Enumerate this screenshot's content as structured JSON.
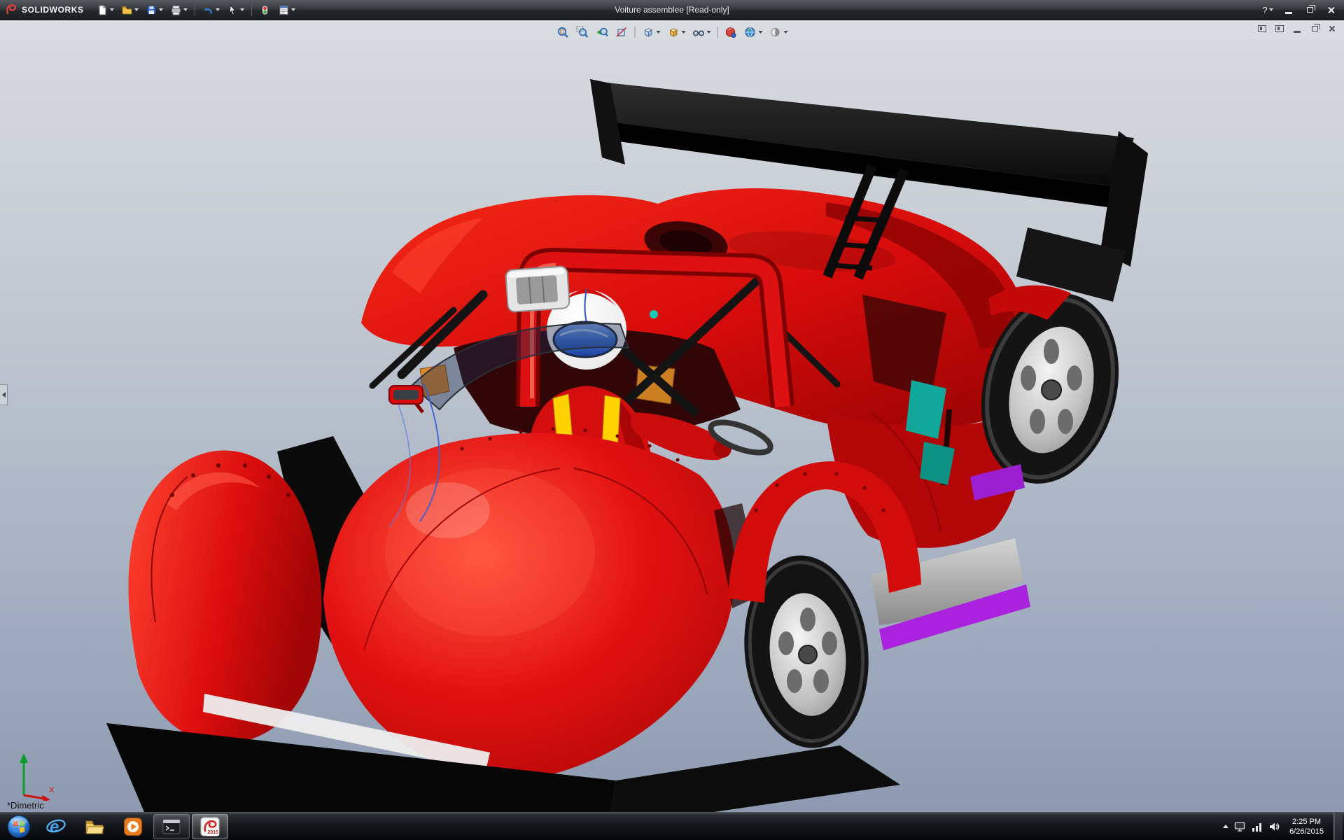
{
  "window": {
    "brand": "SOLIDWORKS",
    "title": "Voiture assemblee [Read-only]",
    "help_glyph": "?"
  },
  "main_toolbar": {
    "items": [
      {
        "name": "new-document",
        "dropdown": true
      },
      {
        "name": "open-document",
        "dropdown": true
      },
      {
        "name": "save",
        "dropdown": true
      },
      {
        "name": "print",
        "dropdown": true
      },
      {
        "name": "undo",
        "dropdown": true
      },
      {
        "name": "select",
        "dropdown": true
      },
      {
        "name": "rebuild",
        "dropdown": false
      },
      {
        "name": "file-properties",
        "dropdown": true
      }
    ]
  },
  "hud_toolbar": {
    "items": [
      "zoom-to-fit",
      "zoom-to-area",
      "previous-view",
      "section-view",
      "view-orientation",
      "display-style",
      "hide-show-items",
      "edit-appearance",
      "apply-scene",
      "view-settings"
    ]
  },
  "viewport": {
    "view_label": "*Dimetric",
    "triad": {
      "x_label": "X"
    }
  },
  "model": {
    "name": "Voiture assemblee",
    "body_color": "#d90c0c",
    "wing_color": "#111111",
    "accent_teal": "#11a79b",
    "accent_magenta": "#aa22dd",
    "rim_color": "#c6c6c6"
  },
  "taskbar": {
    "apps": [
      {
        "name": "internet-explorer",
        "glyph": "e"
      },
      {
        "name": "windows-explorer"
      },
      {
        "name": "media-player"
      },
      {
        "name": "command-prompt"
      },
      {
        "name": "solidworks-2015",
        "active": true,
        "badge": "2015"
      }
    ],
    "tray": {
      "time": "2:25 PM",
      "date": "6/26/2015"
    }
  }
}
